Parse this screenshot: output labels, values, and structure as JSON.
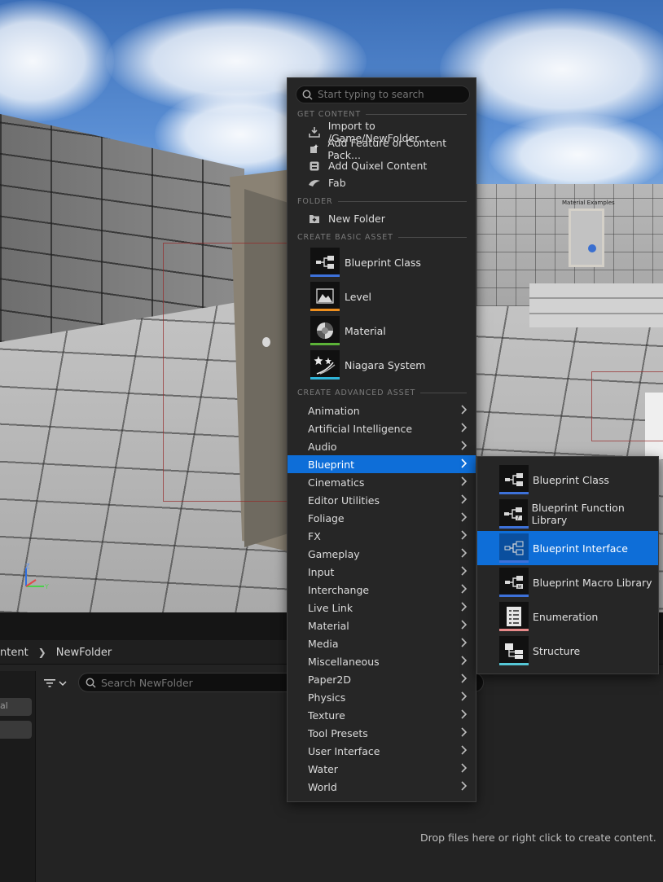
{
  "viewport": {
    "material_label": "Material Examples",
    "gizmo": {
      "z": "Z",
      "y": "Y"
    }
  },
  "menu": {
    "search_placeholder": "Start typing to search",
    "sections": {
      "get_content": "GET CONTENT",
      "folder": "FOLDER",
      "create_basic_asset": "CREATE BASIC ASSET",
      "create_advanced_asset": "CREATE ADVANCED ASSET"
    },
    "get_content_items": [
      {
        "label": "Import to /Game/NewFolder...",
        "icon": "import-icon"
      },
      {
        "label": "Add Feature or Content Pack...",
        "icon": "content-pack-icon"
      },
      {
        "label": "Add Quixel Content",
        "icon": "quixel-icon"
      },
      {
        "label": "Fab",
        "icon": "fab-icon"
      }
    ],
    "folder_items": [
      {
        "label": "New Folder",
        "icon": "new-folder-icon"
      }
    ],
    "basic_assets": [
      {
        "label": "Blueprint Class",
        "icon": "blueprint-class-icon",
        "accent": "#3d71d9"
      },
      {
        "label": "Level",
        "icon": "level-icon",
        "accent": "#ef8f1d"
      },
      {
        "label": "Material",
        "icon": "material-icon",
        "accent": "#5cb338"
      },
      {
        "label": "Niagara System",
        "icon": "niagara-icon",
        "accent": "#2fb4d8"
      }
    ],
    "advanced_assets": [
      {
        "label": "Animation"
      },
      {
        "label": "Artificial Intelligence"
      },
      {
        "label": "Audio"
      },
      {
        "label": "Blueprint",
        "active": true
      },
      {
        "label": "Cinematics"
      },
      {
        "label": "Editor Utilities"
      },
      {
        "label": "Foliage"
      },
      {
        "label": "FX"
      },
      {
        "label": "Gameplay"
      },
      {
        "label": "Input"
      },
      {
        "label": "Interchange"
      },
      {
        "label": "Live Link"
      },
      {
        "label": "Material"
      },
      {
        "label": "Media"
      },
      {
        "label": "Miscellaneous"
      },
      {
        "label": "Paper2D"
      },
      {
        "label": "Physics"
      },
      {
        "label": "Texture"
      },
      {
        "label": "Tool Presets"
      },
      {
        "label": "User Interface"
      },
      {
        "label": "Water"
      },
      {
        "label": "World"
      }
    ]
  },
  "submenu": {
    "items": [
      {
        "label": "Blueprint Class",
        "icon": "blueprint-class-icon",
        "accent": "#3d71d9"
      },
      {
        "label": "Blueprint Function Library",
        "icon": "blueprint-function-library-icon",
        "accent": "#3d71d9"
      },
      {
        "label": "Blueprint Interface",
        "icon": "blueprint-interface-icon",
        "accent": "#3d71d9",
        "active": true
      },
      {
        "label": "Blueprint Macro Library",
        "icon": "blueprint-macro-library-icon",
        "accent": "#3d71d9"
      },
      {
        "label": "Enumeration",
        "icon": "enumeration-icon",
        "accent": "#e88a8a"
      },
      {
        "label": "Structure",
        "icon": "structure-icon",
        "accent": "#55c7d6"
      }
    ]
  },
  "content_browser": {
    "breadcrumb": [
      "ntent",
      "NewFolder"
    ],
    "side_chip_1": "al",
    "search_placeholder": "Search NewFolder",
    "drop_hint": "Drop files here or right click to create content."
  },
  "colors": {
    "highlight": "#0e6ed8",
    "menu_bg": "#262626"
  }
}
